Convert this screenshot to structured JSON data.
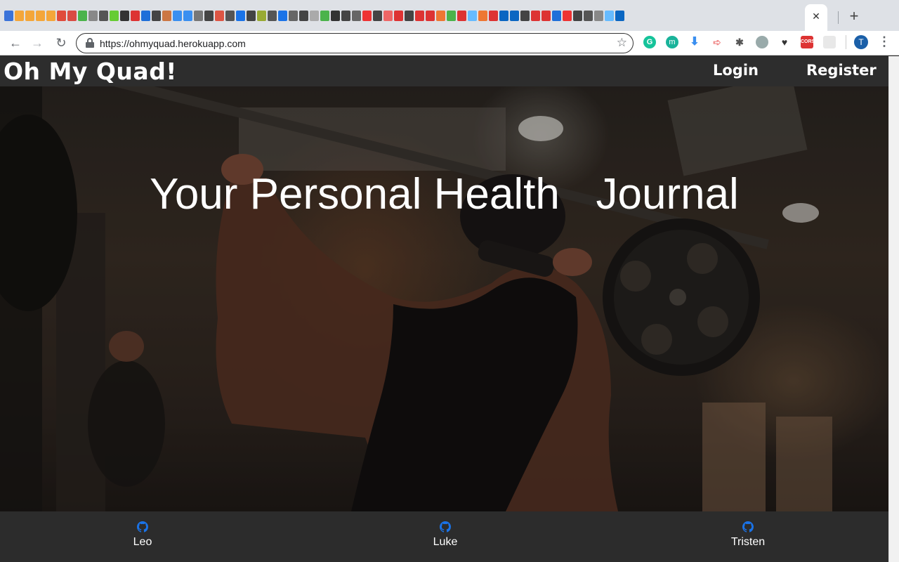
{
  "browser": {
    "url": "https://ohmyquad.herokuapp.com",
    "close_tab_glyph": "✕",
    "new_tab_glyph": "+",
    "profile_initial": "T",
    "ext_cors_label": "CORS",
    "favicon_colors": [
      "#3b73d9",
      "#f4a63a",
      "#f4a63a",
      "#f4a63a",
      "#f4a63a",
      "#e04b3c",
      "#d94c43",
      "#4bb34b",
      "#888",
      "#555",
      "#6c3",
      "#333",
      "#d33",
      "#1e6fd9",
      "#444",
      "#c74",
      "#3a8ff0",
      "#3a8ff0",
      "#777",
      "#444",
      "#d54",
      "#555",
      "#1a73e8",
      "#444",
      "#9a3",
      "#555",
      "#1a73e8",
      "#666",
      "#444",
      "#aaa",
      "#4bb34b",
      "#333",
      "#444",
      "#666",
      "#e33",
      "#444",
      "#e66",
      "#d33",
      "#444",
      "#d33",
      "#d33",
      "#e73",
      "#4bb34b",
      "#d33",
      "#6bf",
      "#e73",
      "#d33",
      "#0a66c2",
      "#0a66c2",
      "#444",
      "#d33",
      "#d33",
      "#1e6fd9",
      "#e33",
      "#444",
      "#555",
      "#888",
      "#6bf",
      "#0a66c2"
    ]
  },
  "site": {
    "brand": "Oh My Quad!",
    "nav": {
      "login": "Login",
      "register": "Register"
    },
    "hero_title": "Your Personal Health   Journal",
    "footer": [
      {
        "name": "Leo",
        "icon": "github-icon"
      },
      {
        "name": "Luke",
        "icon": "github-icon"
      },
      {
        "name": "Tristen",
        "icon": "github-icon"
      }
    ]
  },
  "colors": {
    "navbar_bg": "#2d2d2d",
    "footer_bg": "#2c2c2c",
    "github_icon": "#1a73e8"
  }
}
